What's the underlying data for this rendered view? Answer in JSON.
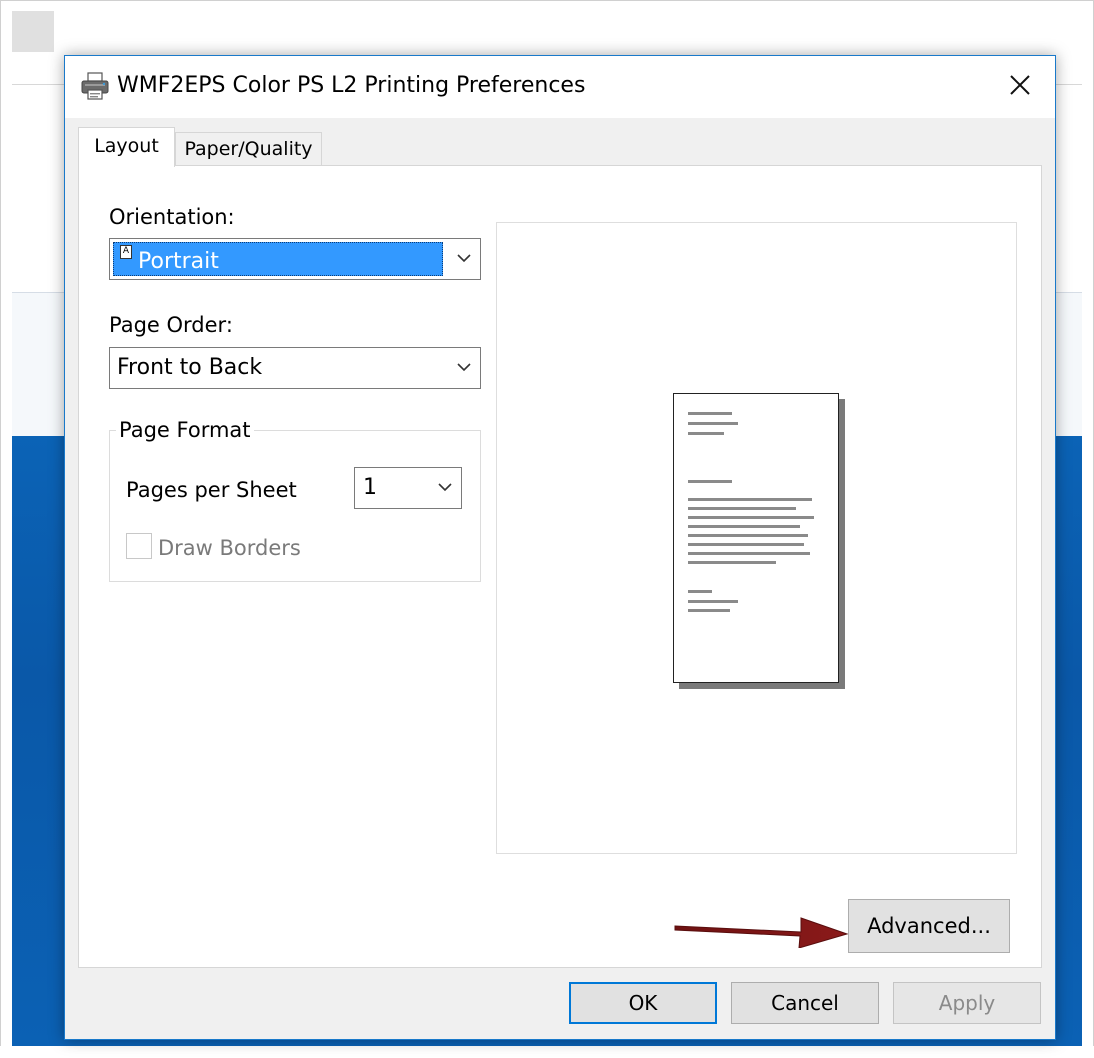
{
  "dialog": {
    "title": "WMF2EPS Color PS L2 Printing Preferences",
    "close_label": "✕"
  },
  "tabs": [
    {
      "label": "Layout",
      "active": true
    },
    {
      "label": "Paper/Quality",
      "active": false
    }
  ],
  "layout": {
    "orientation_label": "Orientation:",
    "orientation_value": "Portrait",
    "page_order_label": "Page Order:",
    "page_order_value": "Front to Back",
    "page_format_label": "Page Format",
    "pages_per_sheet_label": "Pages per Sheet",
    "pages_per_sheet_value": "1",
    "draw_borders_label": "Draw Borders",
    "draw_borders_checked": false,
    "draw_borders_enabled": false
  },
  "advanced_label": "Advanced...",
  "buttons": {
    "ok": "OK",
    "cancel": "Cancel",
    "apply": "Apply"
  },
  "colors": {
    "selection": "#3399ff",
    "focus_border": "#0078d7",
    "arrow": "#8b1a1a",
    "background_accent": "#0b63b6"
  }
}
